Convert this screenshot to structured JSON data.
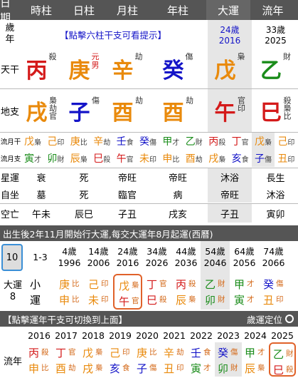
{
  "header": [
    "日期",
    "時柱",
    "日柱",
    "月柱",
    "年柱",
    "大運",
    "流年"
  ],
  "age_label": "歲\n年",
  "hint": "【點擊六柱干支可看提示】",
  "dayun_now": {
    "age": "24歲",
    "year": "2016"
  },
  "liunian_now": {
    "age": "33歲",
    "year": "2025"
  },
  "tiangan_label": "天干",
  "dizhi_label": "地支",
  "stems": [
    {
      "ch": "丙",
      "col": "#d41a1a",
      "tag": "殺"
    },
    {
      "ch": "庚",
      "col": "#e98a0c",
      "tag": "元\n男"
    },
    {
      "ch": "辛",
      "col": "#e98a0c",
      "tag": "劫"
    },
    {
      "ch": "癸",
      "col": "#1414c8",
      "tag": "傷"
    },
    {
      "ch": "戊",
      "col": "#e98a0c",
      "tag": "梟"
    },
    {
      "ch": "乙",
      "col": "#1a8c1a",
      "tag": "財"
    }
  ],
  "branches": [
    {
      "ch": "戌",
      "col": "#e98a0c",
      "tag": "梟劫官"
    },
    {
      "ch": "子",
      "col": "#1414c8",
      "tag": "傷"
    },
    {
      "ch": "酉",
      "col": "#e98a0c",
      "tag": "劫"
    },
    {
      "ch": "酉",
      "col": "#e98a0c",
      "tag": "劫"
    },
    {
      "ch": "午",
      "col": "#d41a1a",
      "tag": "官印"
    },
    {
      "ch": "巳",
      "col": "#d41a1a",
      "tag": "殺梟比"
    }
  ],
  "liuyue_label": "流月干",
  "liuyue_branch_label": "流月支",
  "liuyue_stems": [
    [
      "戊",
      "梟"
    ],
    [
      "己",
      "印"
    ],
    [
      "庚",
      "比"
    ],
    [
      "辛",
      "劫"
    ],
    [
      "壬",
      "食"
    ],
    [
      "癸",
      "傷"
    ],
    [
      "甲",
      "才"
    ],
    [
      "乙",
      "財"
    ],
    [
      "丙",
      "殺"
    ],
    [
      "丁",
      "官"
    ],
    [
      "戊",
      "梟"
    ],
    [
      "己",
      "印"
    ]
  ],
  "liuyue_branches": [
    [
      "寅",
      "才"
    ],
    [
      "卯",
      "財"
    ],
    [
      "辰",
      "梟"
    ],
    [
      "巳",
      "殺"
    ],
    [
      "午",
      "官"
    ],
    [
      "未",
      "印"
    ],
    [
      "申",
      "比"
    ],
    [
      "酉",
      "劫"
    ],
    [
      "戌",
      "梟"
    ],
    [
      "亥",
      "食"
    ],
    [
      "子",
      "傷"
    ],
    [
      "丑",
      "印"
    ]
  ],
  "xingyun_label": "星運",
  "xingyun": [
    "衰",
    "死",
    "帝旺",
    "帝旺",
    "沐浴",
    "長生"
  ],
  "zizuo_label": "自坐",
  "zizuo": [
    "墓",
    "死",
    "臨官",
    "病",
    "帝旺",
    "沐浴"
  ],
  "kongwang_label": "空亡",
  "kongwang": [
    "午未",
    "辰巳",
    "子丑",
    "戌亥",
    "子丑",
    "寅卯"
  ],
  "info_bar": "出生後2年11月開始行大運,每交大運年8月起運(西曆)",
  "dayun_header": {
    "sel": "10",
    "items": [
      [
        "1-3",
        ""
      ],
      [
        "4歲",
        "1996"
      ],
      [
        "14歲",
        "2006"
      ],
      [
        "24歲",
        "2016"
      ],
      [
        "34歲",
        "2026"
      ],
      [
        "44歲",
        "2036"
      ],
      [
        "54歲",
        "2046"
      ],
      [
        "64歲",
        "2056"
      ],
      [
        "74歲",
        "2066"
      ]
    ]
  },
  "dayun_label": "大運\n8",
  "dayun_cells": [
    [
      "小",
      "運",
      "",
      ""
    ],
    [
      "庚",
      "申",
      "比",
      "比"
    ],
    [
      "己",
      "未",
      "印",
      "印"
    ],
    [
      "戊",
      "午",
      "梟",
      "官"
    ],
    [
      "丁",
      "巳",
      "官",
      "殺"
    ],
    [
      "丙",
      "辰",
      "殺",
      "梟"
    ],
    [
      "乙",
      "卯",
      "財",
      "財"
    ],
    [
      "甲",
      "寅",
      "才",
      "才"
    ],
    [
      "癸",
      "丑",
      "傷",
      "印"
    ]
  ],
  "switch_bar": "【點擊運年干支可切換到上面】",
  "locate_label": "歲運定位",
  "liunian_years": [
    "2016",
    "2017",
    "2018",
    "2019",
    "2020",
    "2021",
    "2022",
    "2023",
    "2024",
    "2025"
  ],
  "liunian_label": "流年",
  "liunian_cells": [
    [
      "丙",
      "申",
      "殺",
      "比"
    ],
    [
      "丁",
      "酉",
      "官",
      "劫"
    ],
    [
      "戊",
      "戌",
      "梟",
      "梟"
    ],
    [
      "己",
      "亥",
      "印",
      "食"
    ],
    [
      "庚",
      "子",
      "比",
      "傷"
    ],
    [
      "辛",
      "丑",
      "劫",
      "印"
    ],
    [
      "壬",
      "寅",
      "食",
      "才"
    ],
    [
      "癸",
      "卯",
      "傷",
      "財"
    ],
    [
      "甲",
      "辰",
      "才",
      "梟"
    ],
    [
      "乙",
      "巳",
      "財",
      "殺"
    ]
  ]
}
